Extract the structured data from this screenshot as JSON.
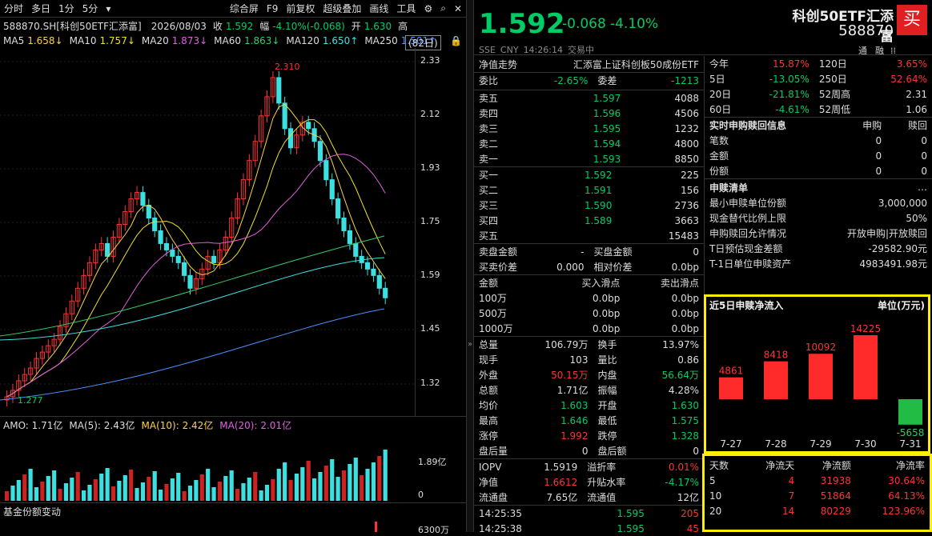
{
  "toolbar": {
    "items": [
      "分时",
      "多日",
      "1分",
      "5分",
      "▾",
      "综合屏",
      "F9",
      "前复权",
      "超级叠加",
      "画线",
      "工具"
    ]
  },
  "info": {
    "code": "588870.SH[科创50ETF汇添富]",
    "date": "2026/08/03",
    "close_label": "收",
    "close": "1.592",
    "amp_label": "幅",
    "amp": "-4.10%(-0.068)",
    "open_label": "开",
    "open": "1.630",
    "high_label": "高",
    "period": "(82日)"
  },
  "ma": [
    {
      "label": "MA5",
      "value": "1.658↓",
      "color": "#ffd23f"
    },
    {
      "label": "MA10",
      "value": "1.757↓",
      "color": "#f0e020"
    },
    {
      "label": "MA20",
      "value": "1.873↓",
      "color": "#e060e0"
    },
    {
      "label": "MA60",
      "value": "1.863↓",
      "color": "#33cc66"
    },
    {
      "label": "MA120",
      "value": "1.650↑",
      "color": "#3ce0e0"
    },
    {
      "label": "MA250",
      "value": "1.501↑",
      "color": "#4a90ff"
    }
  ],
  "yaxis": [
    "2.33",
    "2.12",
    "1.93",
    "1.75",
    "1.59",
    "1.45",
    "1.32"
  ],
  "annot": {
    "high": "2.310",
    "low": "1.277"
  },
  "vol": {
    "amo": "AMO: 1.71亿",
    "ma5": "MA(5): 2.43亿",
    "ma10": "MA(10): 2.42亿",
    "ma20": "MA(20): 2.01亿",
    "y1": "1.89亿",
    "y0": "0"
  },
  "fund": {
    "title": "基金份额变动",
    "y": "6300万"
  },
  "header": {
    "price": "1.592",
    "change": "-0.068",
    "pct": "-4.10%",
    "name": "科创50ETF汇添富",
    "code": "588870",
    "buy": "买",
    "exchange": "SSE",
    "currency": "CNY",
    "time": "14:26:14",
    "status": "交易中",
    "tab1": "通",
    "tab2": "融"
  },
  "nav": {
    "label": "净值走势",
    "fund": "汇添富上证科创板50成份ETF"
  },
  "weibi": {
    "label1": "委比",
    "v1": "-2.65%",
    "label2": "委差",
    "v2": "-1213"
  },
  "asks": [
    {
      "l": "卖五",
      "p": "1.597",
      "v": "4088"
    },
    {
      "l": "卖四",
      "p": "1.596",
      "v": "4506"
    },
    {
      "l": "卖三",
      "p": "1.595",
      "v": "1232"
    },
    {
      "l": "卖二",
      "p": "1.594",
      "v": "4800"
    },
    {
      "l": "卖一",
      "p": "1.593",
      "v": "8850"
    }
  ],
  "bids": [
    {
      "l": "买一",
      "p": "1.592",
      "v": "225"
    },
    {
      "l": "买二",
      "p": "1.591",
      "v": "156"
    },
    {
      "l": "买三",
      "p": "1.590",
      "v": "2736"
    },
    {
      "l": "买四",
      "p": "1.589",
      "v": "3663"
    },
    {
      "l": "买五",
      "p": "",
      "v": "15483"
    }
  ],
  "pan": [
    [
      "卖盘金额",
      "-",
      "买盘金额",
      "0"
    ],
    [
      "买卖价差",
      "0.000",
      "相对价差",
      "0.0bp"
    ]
  ],
  "slip": {
    "h": [
      "金额",
      "买入滑点",
      "卖出滑点"
    ],
    "rows": [
      [
        "100万",
        "0.0bp",
        "0.0bp"
      ],
      [
        "500万",
        "0.0bp",
        "0.0bp"
      ],
      [
        "1000万",
        "0.0bp",
        "0.0bp"
      ]
    ]
  },
  "stats": [
    [
      "总量",
      "106.79万",
      "换手",
      "13.97%"
    ],
    [
      "现手",
      "103",
      "量比",
      "0.86"
    ],
    [
      "外盘",
      "50.15万",
      "内盘",
      "56.64万"
    ],
    [
      "总额",
      "1.71亿",
      "振幅",
      "4.28%"
    ],
    [
      "均价",
      "1.603",
      "开盘",
      "1.630"
    ],
    [
      "最高",
      "1.646",
      "最低",
      "1.575"
    ],
    [
      "涨停",
      "1.992",
      "跌停",
      "1.328"
    ],
    [
      "盘后量",
      "0",
      "盘后额",
      "0"
    ]
  ],
  "iopv": [
    [
      "IOPV",
      "1.5919",
      "溢折率",
      "0.01%"
    ],
    [
      "净值",
      "1.6612",
      "升贴水率",
      "-4.17%"
    ],
    [
      "流通盘",
      "7.65亿",
      "流通值",
      "12亿"
    ]
  ],
  "ticks": [
    {
      "t": "14:25:35",
      "p": "1.595",
      "v": "205"
    },
    {
      "t": "14:25:38",
      "p": "1.595",
      "v": "45"
    }
  ],
  "perf": [
    [
      "今年",
      "15.87%",
      "120日",
      "3.65%"
    ],
    [
      "5日",
      "-13.05%",
      "250日",
      "52.64%"
    ],
    [
      "20日",
      "-21.81%",
      "52周高",
      "2.31"
    ],
    [
      "60日",
      "-4.61%",
      "52周低",
      "1.06"
    ]
  ],
  "subred": {
    "h": [
      "实时申购赎回信息",
      "申购",
      "赎回"
    ],
    "rows": [
      [
        "笔数",
        "0",
        "0"
      ],
      [
        "金额",
        "0",
        "0"
      ],
      [
        "份额",
        "0",
        "0"
      ]
    ]
  },
  "list": {
    "title": "申赎清单",
    "more": "…",
    "rows": [
      [
        "最小申赎单位份额",
        "3,000,000"
      ],
      [
        "现金替代比例上限",
        "50%"
      ],
      [
        "申购赎回允许情况",
        "开放申购|开放赎回"
      ],
      [
        "T日预估现金差额",
        "-29582.90元"
      ],
      [
        "T-1日单位申赎资产",
        "4983491.98元"
      ]
    ]
  },
  "flow": {
    "title": "近5日申赎净流入",
    "unit": "单位(万元)"
  },
  "chart_data": {
    "type": "bar",
    "title": "近5日申赎净流入",
    "ylabel": "单位(万元)",
    "categories": [
      "7-27",
      "7-28",
      "7-29",
      "7-30",
      "7-31"
    ],
    "values": [
      4861,
      8418,
      10092,
      14225,
      -5658
    ]
  },
  "flowtable": {
    "h": [
      "天数",
      "净流天",
      "净流额",
      "净流率"
    ],
    "rows": [
      [
        "5",
        "4",
        "31938",
        "30.64%"
      ],
      [
        "10",
        "7",
        "51864",
        "64.13%"
      ],
      [
        "20",
        "14",
        "80229",
        "123.96%"
      ]
    ]
  }
}
